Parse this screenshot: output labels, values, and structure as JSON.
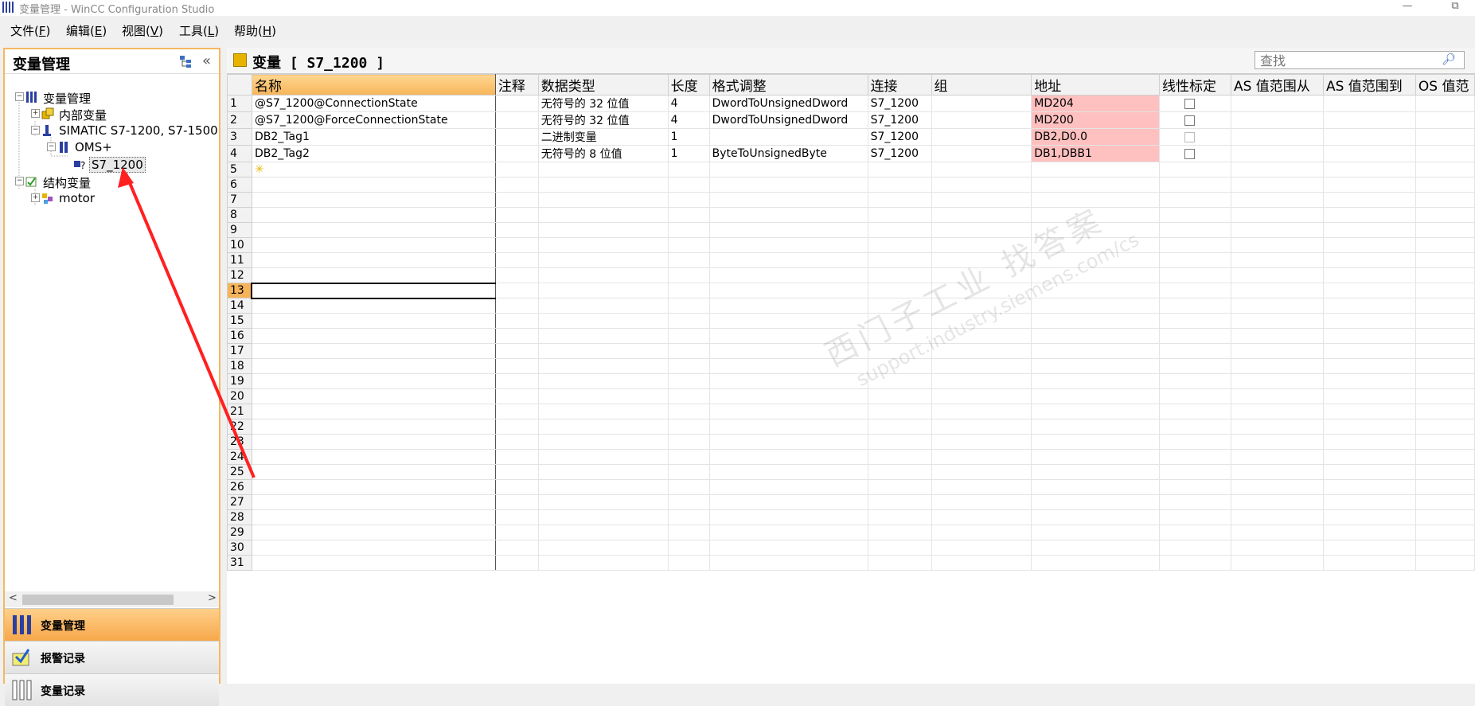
{
  "window": {
    "title": "变量管理 - WinCC Configuration Studio",
    "restore_glyph": "⧉",
    "minimize_glyph": "—"
  },
  "menu": [
    {
      "label": "文件(",
      "key": "F",
      "end": ")"
    },
    {
      "label": "编辑(",
      "key": "E",
      "end": ")"
    },
    {
      "label": "视图(",
      "key": "V",
      "end": ")"
    },
    {
      "label": "工具(",
      "key": "L",
      "end": ")"
    },
    {
      "label": "帮助(",
      "key": "H",
      "end": ")"
    }
  ],
  "navigator": {
    "title": "变量管理",
    "collapse_glyph": "«",
    "tree": [
      {
        "label": "变量管理",
        "icon": "tag-management-icon"
      },
      {
        "label": "内部变量",
        "icon": "internal-tags-icon"
      },
      {
        "label": "SIMATIC S7-1200, S7-1500",
        "icon": "channel-icon"
      },
      {
        "label": "OMS+",
        "icon": "connection-folder-icon"
      },
      {
        "label": "S7_1200",
        "icon": "connection-icon"
      },
      {
        "label": "结构变量",
        "icon": "structure-tags-icon"
      },
      {
        "label": "motor",
        "icon": "structure-icon"
      }
    ],
    "scroll_left": "<",
    "scroll_right": ">",
    "splitter": "·····",
    "bottom_nav": [
      {
        "label": "变量管理",
        "icon": "tag-management-icon"
      },
      {
        "label": "报警记录",
        "icon": "alarm-logging-icon"
      },
      {
        "label": "变量记录",
        "icon": "tag-logging-icon"
      }
    ]
  },
  "editor": {
    "title": "变量 [ S7_1200 ]",
    "search_placeholder": "查找",
    "columns": [
      "名称",
      "注释",
      "数据类型",
      "长度",
      "格式调整",
      "连接",
      "组",
      "地址",
      "线性标定",
      "AS 值范围从",
      "AS 值范围到",
      "OS 值范"
    ],
    "rows": [
      {
        "no": "1",
        "name": "@S7_1200@ConnectionState",
        "comment": "",
        "type": "无符号的 32 位值",
        "length": "4",
        "format": "DwordToUnsignedDword",
        "connection": "S7_1200",
        "group": "",
        "address": "MD204",
        "linear": "unchecked"
      },
      {
        "no": "2",
        "name": "@S7_1200@ForceConnectionState",
        "comment": "",
        "type": "无符号的 32 位值",
        "length": "4",
        "format": "DwordToUnsignedDword",
        "connection": "S7_1200",
        "group": "",
        "address": "MD200",
        "linear": "unchecked"
      },
      {
        "no": "3",
        "name": "DB2_Tag1",
        "comment": "",
        "type": "二进制变量",
        "length": "1",
        "format": "",
        "connection": "S7_1200",
        "group": "",
        "address": "DB2,D0.0",
        "linear": "disabled"
      },
      {
        "no": "4",
        "name": "DB2_Tag2",
        "comment": "",
        "type": "无符号的 8 位值",
        "length": "1",
        "format": "ByteToUnsignedByte",
        "connection": "S7_1200",
        "group": "",
        "address": "DB1,DBB1",
        "linear": "unchecked"
      }
    ],
    "new_row_icon": "new-row-star-icon",
    "empty_row_numbers": [
      "5",
      "6",
      "7",
      "8",
      "9",
      "10",
      "11",
      "12",
      "13",
      "14",
      "15",
      "16",
      "17",
      "18",
      "19",
      "20",
      "21",
      "22",
      "23",
      "24",
      "25",
      "26",
      "27",
      "28",
      "29",
      "30",
      "31"
    ],
    "selected_row": "13"
  },
  "watermark": {
    "line1": "西门子工业  找答案",
    "line2": "support.industry.siemens.com/cs"
  },
  "annotation_arrow_color": "#ff2020",
  "colors": {
    "accent": "#f6b45a",
    "address_cell": "#ffc0c0"
  }
}
